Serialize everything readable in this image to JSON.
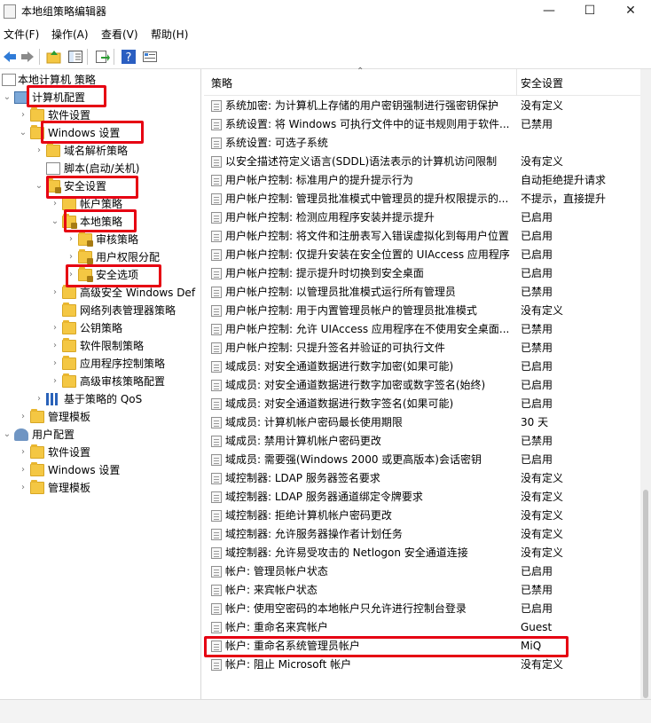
{
  "window": {
    "title": "本地组策略编辑器",
    "minimize": "—",
    "maximize": "☐",
    "close": "✕"
  },
  "menu": [
    "文件(F)",
    "操作(A)",
    "查看(V)",
    "帮助(H)"
  ],
  "toolbar_icons": [
    "back-arrow-icon",
    "forward-arrow-icon",
    "up-folder-icon",
    "show-hide-tree-icon",
    "export-list-icon",
    "help-icon",
    "properties-icon"
  ],
  "tree": [
    {
      "label": "本地计算机 策略"
    },
    {
      "label": "计算机配置"
    },
    {
      "label": "软件设置"
    },
    {
      "label": "Windows 设置"
    },
    {
      "label": "域名解析策略"
    },
    {
      "label": "脚本(启动/关机)"
    },
    {
      "label": "安全设置"
    },
    {
      "label": "帐户策略"
    },
    {
      "label": "本地策略"
    },
    {
      "label": "审核策略"
    },
    {
      "label": "用户权限分配"
    },
    {
      "label": "安全选项"
    },
    {
      "label": "高级安全 Windows Def"
    },
    {
      "label": "网络列表管理器策略"
    },
    {
      "label": "公钥策略"
    },
    {
      "label": "软件限制策略"
    },
    {
      "label": "应用程序控制策略"
    },
    {
      "label": "高级审核策略配置"
    },
    {
      "label": "基于策略的 QoS"
    },
    {
      "label": "管理模板"
    },
    {
      "label": "用户配置"
    },
    {
      "label": "软件设置"
    },
    {
      "label": "Windows 设置"
    },
    {
      "label": "管理模板"
    }
  ],
  "list": {
    "columns": [
      "策略",
      "安全设置"
    ],
    "rows": [
      {
        "name": "系统加密: 为计算机上存储的用户密钥强制进行强密钥保护",
        "value": "没有定义"
      },
      {
        "name": "系统设置: 将 Windows 可执行文件中的证书规则用于软件...",
        "value": "已禁用"
      },
      {
        "name": "系统设置: 可选子系统",
        "value": ""
      },
      {
        "name": "以安全描述符定义语言(SDDL)语法表示的计算机访问限制",
        "value": "没有定义"
      },
      {
        "name": "用户帐户控制: 标准用户的提升提示行为",
        "value": "自动拒绝提升请求"
      },
      {
        "name": "用户帐户控制: 管理员批准模式中管理员的提升权限提示的...",
        "value": "不提示，直接提升"
      },
      {
        "name": "用户帐户控制: 检测应用程序安装并提示提升",
        "value": "已启用"
      },
      {
        "name": "用户帐户控制: 将文件和注册表写入错误虚拟化到每用户位置",
        "value": "已启用"
      },
      {
        "name": "用户帐户控制: 仅提升安装在安全位置的 UIAccess 应用程序",
        "value": "已启用"
      },
      {
        "name": "用户帐户控制: 提示提升时切换到安全桌面",
        "value": "已启用"
      },
      {
        "name": "用户帐户控制: 以管理员批准模式运行所有管理员",
        "value": "已禁用"
      },
      {
        "name": "用户帐户控制: 用于内置管理员帐户的管理员批准模式",
        "value": "没有定义"
      },
      {
        "name": "用户帐户控制: 允许 UIAccess 应用程序在不使用安全桌面...",
        "value": "已禁用"
      },
      {
        "name": "用户帐户控制: 只提升签名并验证的可执行文件",
        "value": "已禁用"
      },
      {
        "name": "域成员: 对安全通道数据进行数字加密(如果可能)",
        "value": "已启用"
      },
      {
        "name": "域成员: 对安全通道数据进行数字加密或数字签名(始终)",
        "value": "已启用"
      },
      {
        "name": "域成员: 对安全通道数据进行数字签名(如果可能)",
        "value": "已启用"
      },
      {
        "name": "域成员: 计算机帐户密码最长使用期限",
        "value": "30 天"
      },
      {
        "name": "域成员: 禁用计算机帐户密码更改",
        "value": "已禁用"
      },
      {
        "name": "域成员: 需要强(Windows 2000 或更高版本)会话密钥",
        "value": "已启用"
      },
      {
        "name": "域控制器: LDAP 服务器签名要求",
        "value": "没有定义"
      },
      {
        "name": "域控制器: LDAP 服务器通道绑定令牌要求",
        "value": "没有定义"
      },
      {
        "name": "域控制器: 拒绝计算机帐户密码更改",
        "value": "没有定义"
      },
      {
        "name": "域控制器: 允许服务器操作者计划任务",
        "value": "没有定义"
      },
      {
        "name": "域控制器: 允许易受攻击的 Netlogon 安全通道连接",
        "value": "没有定义"
      },
      {
        "name": "帐户: 管理员帐户状态",
        "value": "已启用"
      },
      {
        "name": "帐户: 来宾帐户状态",
        "value": "已禁用"
      },
      {
        "name": "帐户: 使用空密码的本地帐户只允许进行控制台登录",
        "value": "已启用"
      },
      {
        "name": "帐户: 重命名来宾帐户",
        "value": "Guest"
      },
      {
        "name": "帐户: 重命名系统管理员帐户",
        "value": "MiQ"
      },
      {
        "name": "帐户: 阻止 Microsoft 帐户",
        "value": "没有定义"
      }
    ]
  },
  "annotation_color": "#e60012"
}
